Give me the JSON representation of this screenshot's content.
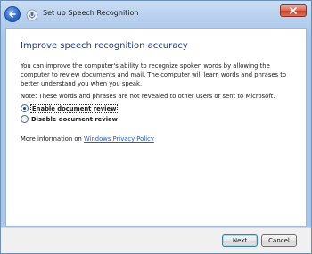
{
  "window": {
    "title": "Set up Speech Recognition"
  },
  "page": {
    "heading": "Improve speech recognition accuracy",
    "description": "You can improve the computer's ability to recognize spoken words by allowing the computer to review documents and mail. The computer will learn words and phrases to better understand you when you speak.",
    "note": "Note: These words and phrases are not revealed to other users or sent to Microsoft.",
    "options": [
      {
        "label": "Enable document review",
        "selected": true
      },
      {
        "label": "Disable document review",
        "selected": false
      }
    ],
    "more_info_prefix": "More information on ",
    "privacy_link": "Windows Privacy Policy"
  },
  "footer": {
    "next_label": "Next",
    "cancel_label": "Cancel"
  },
  "colors": {
    "heading": "#1f3d8c",
    "link": "#1f5fc4",
    "close_button": "#c8432a"
  },
  "icons": {
    "back": "back-arrow-icon",
    "app": "speech-recognition-icon",
    "close": "close-icon"
  }
}
